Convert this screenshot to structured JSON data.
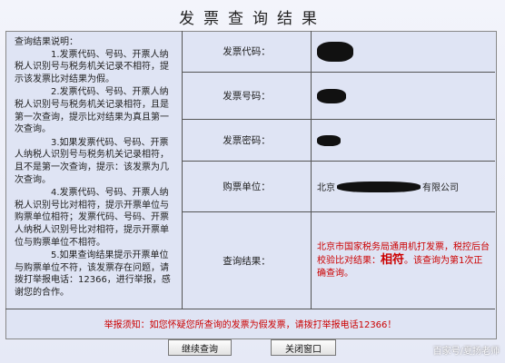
{
  "title": "发票查询结果",
  "explanation": {
    "heading": "查询结果说明：",
    "items": [
      "1.发票代码、号码、开票人纳税人识别号与税务机关记录不相符，提示该发票比对结果为假。",
      "2.发票代码、号码、开票人纳税人识别号与税务机关记录相符，且是第一次查询，提示比对结果为真且第一次查询。",
      "3.如果发票代码、号码、开票人纳税人识别号与税务机关记录相符，且不是第一次查询，提示：该发票为几次查询。",
      "4.发票代码、号码、开票人纳税人识别号比对相符，提示开票单位与购票单位相符；发票代码、号码、开票人纳税人识别号比对相符，提示开票单位与购票单位不相符。",
      "5.如果查询结果提示开票单位与购票单位不符，该发票存在问题，请拨打举报电话：12366，进行举报，感谢您的合作。"
    ]
  },
  "fields": {
    "code_label": "发票代码：",
    "number_label": "发票号码：",
    "password_label": "发票密码：",
    "buyer_label": "购票单位：",
    "buyer_prefix": "北京",
    "buyer_suffix": "有限公司",
    "result_label": "查询结果："
  },
  "result": {
    "part1": "北京市国家税务局通用机打发票，税控后台校验比对结果：",
    "verdict": "相符",
    "part2": "。该查询为第1次正确查询。"
  },
  "notice": "举报须知：如您怀疑您所查询的发票为假发票，请拨打举报电话12366！",
  "buttons": {
    "continue": "继续查询",
    "close": "关闭窗口"
  },
  "watermark": "百家号/夏扬老师"
}
